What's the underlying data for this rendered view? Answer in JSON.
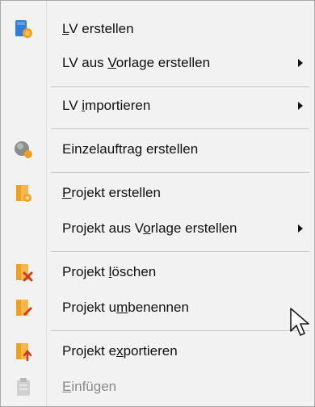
{
  "menu": {
    "items": [
      {
        "pre": "",
        "key": "L",
        "post": "V erstellen",
        "icon": "lv-create-icon",
        "submenu": false,
        "disabled": false
      },
      {
        "pre": "LV aus ",
        "key": "V",
        "post": "orlage erstellen",
        "icon": "",
        "submenu": true,
        "disabled": false
      },
      {
        "pre": "LV ",
        "key": "i",
        "post": "mportieren",
        "icon": "",
        "submenu": true,
        "disabled": false
      },
      {
        "pre": "",
        "key": "",
        "post": "Einzelauftrag erstellen",
        "icon": "single-order-icon",
        "submenu": false,
        "disabled": false
      },
      {
        "pre": "",
        "key": "P",
        "post": "rojekt erstellen",
        "icon": "project-create-icon",
        "submenu": false,
        "disabled": false
      },
      {
        "pre": "Projekt aus V",
        "key": "o",
        "post": "rlage erstellen",
        "icon": "",
        "submenu": true,
        "disabled": false
      },
      {
        "pre": "Projekt ",
        "key": "l",
        "post": "öschen",
        "icon": "project-delete-icon",
        "submenu": false,
        "disabled": false
      },
      {
        "pre": "Projekt u",
        "key": "m",
        "post": "benennen",
        "icon": "project-rename-icon",
        "submenu": false,
        "disabled": false
      },
      {
        "pre": "Projekt e",
        "key": "x",
        "post": "portieren",
        "icon": "project-export-icon",
        "submenu": false,
        "disabled": false
      },
      {
        "pre": "",
        "key": "E",
        "post": "infügen",
        "icon": "paste-icon",
        "submenu": false,
        "disabled": true
      }
    ]
  },
  "colors": {
    "blue": "#2f7fd8",
    "orange": "#f0a020",
    "gray": "#8c8c8c",
    "red": "#d23a1e",
    "disabled": "#8a8a8a"
  }
}
